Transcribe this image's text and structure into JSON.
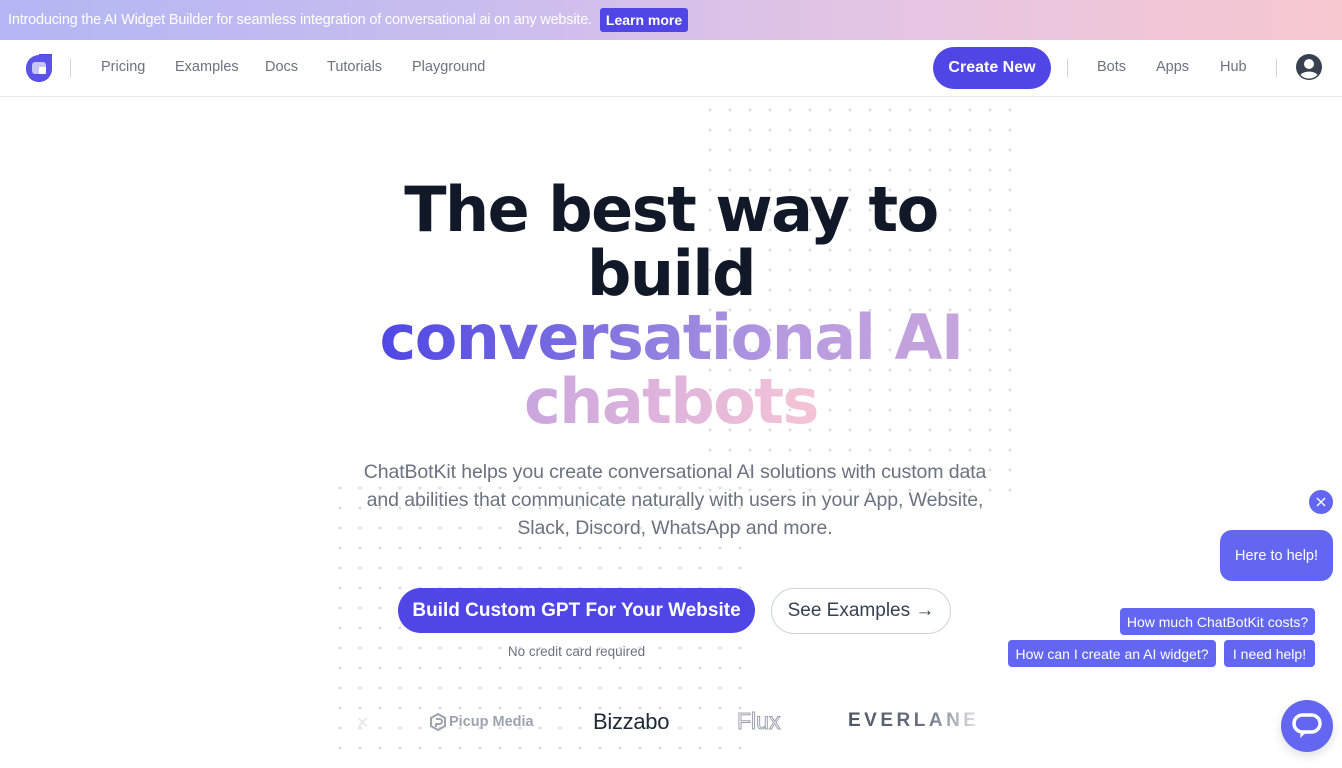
{
  "banner": {
    "text": "Introducing the AI Widget Builder for seamless integration of conversational ai on any website.",
    "cta_label": "Learn more"
  },
  "nav": {
    "logo_icon": "chatbotkit-logo-icon",
    "left_links": [
      {
        "label": "Pricing"
      },
      {
        "label": "Examples"
      },
      {
        "label": "Docs"
      },
      {
        "label": "Tutorials"
      },
      {
        "label": "Playground"
      }
    ],
    "create_label": "Create New",
    "right_links": [
      {
        "label": "Bots"
      },
      {
        "label": "Apps"
      },
      {
        "label": "Hub"
      }
    ],
    "avatar_icon": "user-circle-icon"
  },
  "hero": {
    "title_line1": "The best way to",
    "title_line2": "build",
    "title_line3": "conversational AI",
    "title_line4": "chatbots",
    "subtitle": "ChatBotKit helps you create conversational AI solutions with custom data and abilities that communicate naturally with users in your App, Website, Slack, Discord, WhatsApp and more.",
    "primary_cta": "Build Custom GPT For Your Website",
    "secondary_cta": "See Examples →",
    "note": "No credit card required"
  },
  "logos": [
    "Picup Media",
    "Bizzabo",
    "Flux",
    "EVERLANE"
  ],
  "chat_widget": {
    "close_icon": "close-icon",
    "greeting": "Here to help!",
    "suggestions": [
      {
        "label": "How much ChatBotKit costs?"
      },
      {
        "label": "How can I create an AI widget?"
      },
      {
        "label": "I need help!"
      }
    ],
    "launcher_icon": "chat-bubble-icon"
  },
  "colors": {
    "accent": "#4f46e5",
    "widget": "#6366f1",
    "text_dark": "#111827",
    "text_muted": "#6b7280"
  }
}
